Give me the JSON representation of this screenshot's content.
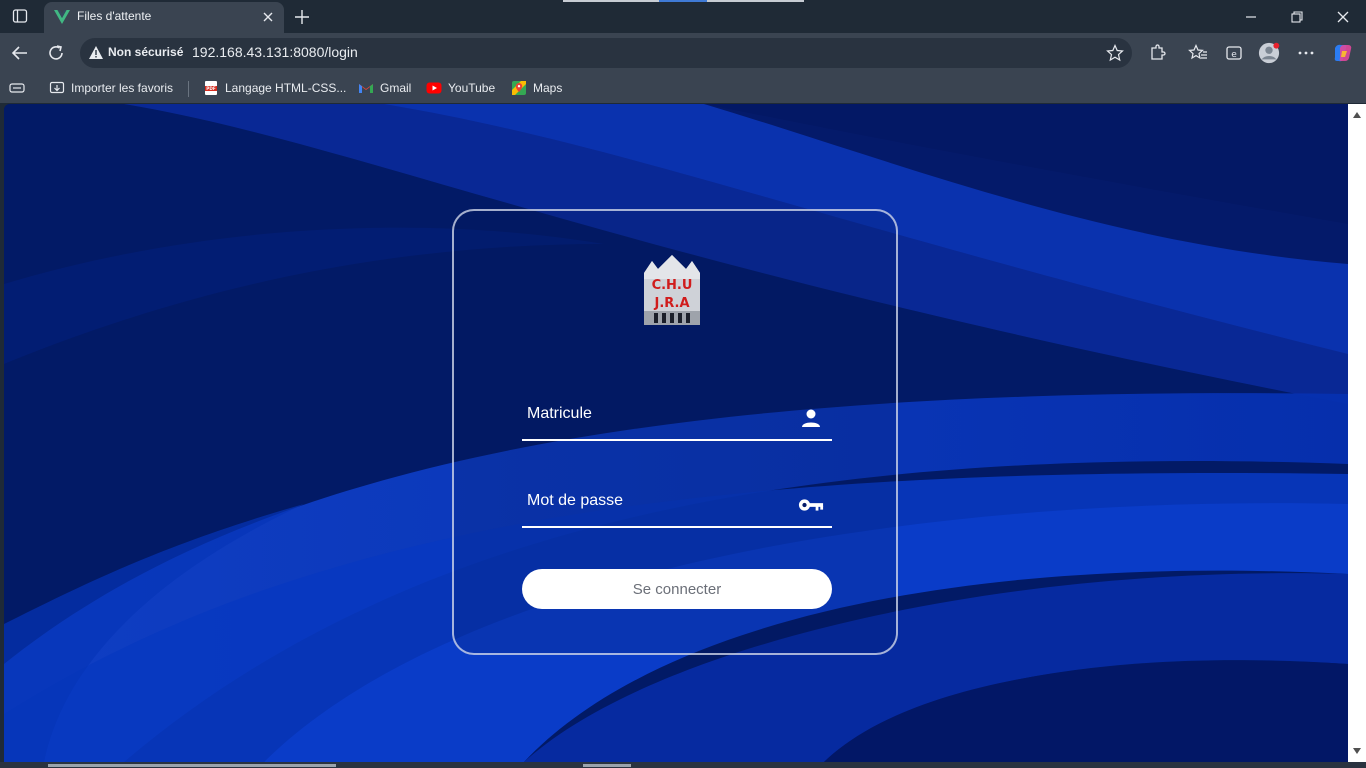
{
  "browser": {
    "tab": {
      "title": "Files d'attente",
      "favicon": "vue-logo-icon"
    },
    "address": {
      "security_label": "Non sécurisé",
      "url": "192.168.43.131:8080/login"
    },
    "bookmarks": [
      {
        "label": "Importer les favoris",
        "icon": "import-favorites-icon"
      },
      {
        "label": "Langage HTML-CSS...",
        "icon": "pdf-icon"
      },
      {
        "label": "Gmail",
        "icon": "gmail-icon"
      },
      {
        "label": "YouTube",
        "icon": "youtube-icon"
      },
      {
        "label": "Maps",
        "icon": "maps-icon"
      }
    ]
  },
  "login": {
    "logo_text": [
      "C.H.U",
      "J.R.A"
    ],
    "matricule_placeholder": "Matricule",
    "password_placeholder": "Mot de passe",
    "submit_label": "Se connecter"
  },
  "colors": {
    "background": "#02185f",
    "accent_red": "#d01c1c",
    "button": "#ffffff"
  }
}
